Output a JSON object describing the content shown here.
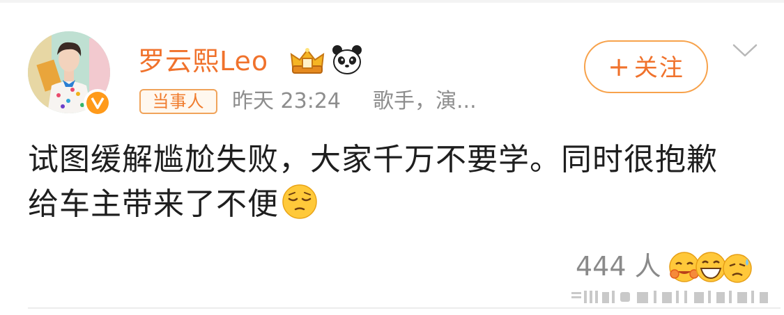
{
  "post": {
    "author": {
      "name": "罗云熙Leo",
      "tag": "当事人",
      "time": "昨天 23:24",
      "description": "歌手，演..."
    },
    "follow_button": {
      "label": "关注",
      "icon": "plus-icon"
    },
    "text_line1": "试图缓解尴尬失败，大家千万不要学。同时很抱歉",
    "text_line2": "给车主带来了不便",
    "reactions": {
      "count": "444 人"
    }
  },
  "colors": {
    "accent": "#f0722c",
    "badge_orange": "#ff9a1a",
    "muted_text": "#8d8d8d",
    "button_border": "#f7a24b"
  },
  "icons": [
    "verified-icon",
    "crown-badge-icon",
    "panda-icon",
    "chevron-down-icon",
    "pensive-face-emoji",
    "hug-emoji",
    "laugh-emoji",
    "sweat-emoji"
  ]
}
